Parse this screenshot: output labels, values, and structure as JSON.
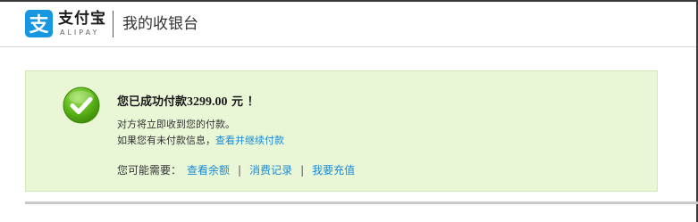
{
  "header": {
    "logo_cn": "支付宝",
    "logo_en": "ALIPAY",
    "page_title": "我的收银台"
  },
  "success": {
    "prefix": "您已成功付款",
    "amount": "3299.00",
    "suffix": " 元 ！",
    "line1": "对方将立即收到您的付款。",
    "line2_text": "如果您有未付款信息，",
    "line2_link": "查看并继续付款",
    "needs_label": "您可能需要：",
    "links": [
      "查看余额",
      "消费记录",
      "我要充值"
    ],
    "separator": "|"
  },
  "colors": {
    "brand_blue": "#1797e0",
    "panel_bg": "#eaf7d7",
    "link": "#1a8ad3",
    "check_green": "#5cb518"
  },
  "icons": {
    "logo": "alipay-logo-icon",
    "success": "check-circle-icon"
  }
}
